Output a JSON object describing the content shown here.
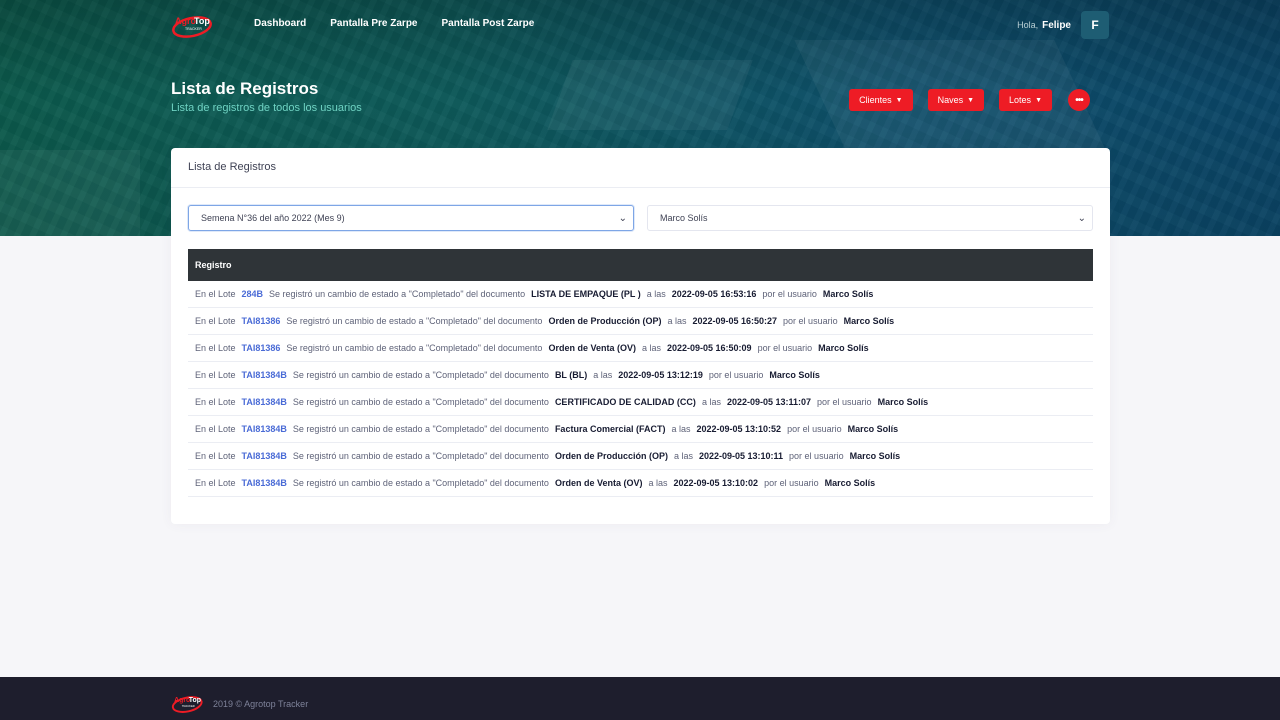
{
  "nav": {
    "logo_text": "AgroTop",
    "logo_sub": "TRACKER",
    "links": [
      "Dashboard",
      "Pantalla Pre Zarpe",
      "Pantalla Post Zarpe"
    ],
    "greeting": "Hola,",
    "user_name": "Felipe",
    "avatar_letter": "F"
  },
  "subheader": {
    "title": "Lista de Registros",
    "subtitle": "Lista de registros de todos los usuarios",
    "buttons": [
      "Clientes",
      "Naves",
      "Lotes"
    ]
  },
  "card": {
    "title": "Lista de Registros",
    "week_select": "Semena N°36 del año 2022 (Mes 9)",
    "user_select": "Marco Solís",
    "table_header": "Registro"
  },
  "rows": [
    {
      "prefix": "En el Lote",
      "lot": "284B",
      "mid": "Se registró un cambio de estado a \"Completado\" del documento",
      "doc": "LISTA DE EMPAQUE (PL )",
      "at": "a las",
      "date": "2022-09-05 16:53:16",
      "by": "por el usuario",
      "user": "Marco Solís"
    },
    {
      "prefix": "En el Lote",
      "lot": "TAI81386",
      "mid": "Se registró un cambio de estado a \"Completado\" del documento",
      "doc": "Orden de Producción (OP)",
      "at": "a las",
      "date": "2022-09-05 16:50:27",
      "by": "por el usuario",
      "user": "Marco Solís"
    },
    {
      "prefix": "En el Lote",
      "lot": "TAI81386",
      "mid": "Se registró un cambio de estado a \"Completado\" del documento",
      "doc": "Orden de Venta (OV)",
      "at": "a las",
      "date": "2022-09-05 16:50:09",
      "by": "por el usuario",
      "user": "Marco Solís"
    },
    {
      "prefix": "En el Lote",
      "lot": "TAI81384B",
      "mid": "Se registró un cambio de estado a \"Completado\" del documento",
      "doc": "BL (BL)",
      "at": "a las",
      "date": "2022-09-05 13:12:19",
      "by": "por el usuario",
      "user": "Marco Solís"
    },
    {
      "prefix": "En el Lote",
      "lot": "TAI81384B",
      "mid": "Se registró un cambio de estado a \"Completado\" del documento",
      "doc": "CERTIFICADO DE CALIDAD (CC)",
      "at": "a las",
      "date": "2022-09-05 13:11:07",
      "by": "por el usuario",
      "user": "Marco Solís"
    },
    {
      "prefix": "En el Lote",
      "lot": "TAI81384B",
      "mid": "Se registró un cambio de estado a \"Completado\" del documento",
      "doc": "Factura Comercial (FACT)",
      "at": "a las",
      "date": "2022-09-05 13:10:52",
      "by": "por el usuario",
      "user": "Marco Solís"
    },
    {
      "prefix": "En el Lote",
      "lot": "TAI81384B",
      "mid": "Se registró un cambio de estado a \"Completado\" del documento",
      "doc": "Orden de Producción (OP)",
      "at": "a las",
      "date": "2022-09-05 13:10:11",
      "by": "por el usuario",
      "user": "Marco Solís"
    },
    {
      "prefix": "En el Lote",
      "lot": "TAI81384B",
      "mid": "Se registró un cambio de estado a \"Completado\" del documento",
      "doc": "Orden de Venta (OV)",
      "at": "a las",
      "date": "2022-09-05 13:10:02",
      "by": "por el usuario",
      "user": "Marco Solís"
    }
  ],
  "footer": {
    "copyright": "2019 ©  Agrotop Tracker"
  },
  "colors": {
    "accent_red": "#ee1c25",
    "link_blue": "#4a6bd6",
    "table_header": "#2f3438",
    "footer_bg": "#1e1e2d"
  },
  "icons": {
    "caret": "chevron-down-icon",
    "more": "more-dots-icon"
  }
}
